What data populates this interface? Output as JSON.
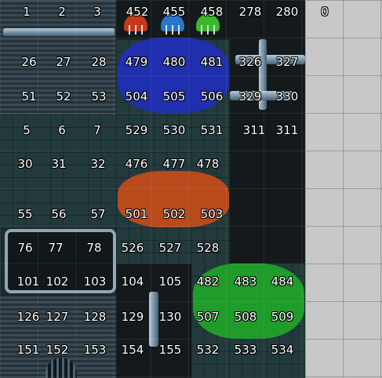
{
  "tile_labels": [
    {
      "label": "1"
    },
    {
      "label": "2"
    },
    {
      "label": "3"
    },
    {
      "label": "452"
    },
    {
      "label": "455"
    },
    {
      "label": "458"
    },
    {
      "label": "278"
    },
    {
      "label": "280"
    },
    {
      "label": "0"
    },
    {
      "label": "26"
    },
    {
      "label": "27"
    },
    {
      "label": "28"
    },
    {
      "label": "479"
    },
    {
      "label": "480"
    },
    {
      "label": "481"
    },
    {
      "label": "326"
    },
    {
      "label": "327"
    },
    {
      "label": "51"
    },
    {
      "label": "52"
    },
    {
      "label": "53"
    },
    {
      "label": "504"
    },
    {
      "label": "505"
    },
    {
      "label": "506"
    },
    {
      "label": "329"
    },
    {
      "label": "330"
    },
    {
      "label": "5"
    },
    {
      "label": "6"
    },
    {
      "label": "7"
    },
    {
      "label": "529"
    },
    {
      "label": "530"
    },
    {
      "label": "531"
    },
    {
      "label": "311"
    },
    {
      "label": "311"
    },
    {
      "label": "30"
    },
    {
      "label": "31"
    },
    {
      "label": "32"
    },
    {
      "label": "476"
    },
    {
      "label": "477"
    },
    {
      "label": "478"
    },
    {
      "label": "55"
    },
    {
      "label": "56"
    },
    {
      "label": "57"
    },
    {
      "label": "501"
    },
    {
      "label": "502"
    },
    {
      "label": "503"
    },
    {
      "label": "76"
    },
    {
      "label": "77"
    },
    {
      "label": "78"
    },
    {
      "label": "526"
    },
    {
      "label": "527"
    },
    {
      "label": "528"
    },
    {
      "label": "101"
    },
    {
      "label": "102"
    },
    {
      "label": "103"
    },
    {
      "label": "104"
    },
    {
      "label": "105"
    },
    {
      "label": "482"
    },
    {
      "label": "483"
    },
    {
      "label": "484"
    },
    {
      "label": "126"
    },
    {
      "label": "127"
    },
    {
      "label": "128"
    },
    {
      "label": "129"
    },
    {
      "label": "130"
    },
    {
      "label": "507"
    },
    {
      "label": "508"
    },
    {
      "label": "509"
    },
    {
      "label": "151"
    },
    {
      "label": "152"
    },
    {
      "label": "153"
    },
    {
      "label": "154"
    },
    {
      "label": "155"
    },
    {
      "label": "532"
    },
    {
      "label": "533"
    },
    {
      "label": "534"
    }
  ],
  "colors": {
    "blue_zone": "#1f2fae",
    "orange_zone": "#b84a1c",
    "green_zone": "#1f9c2a",
    "bulb_red": "#c63a1c",
    "bulb_blue": "#2a76c6",
    "bulb_green": "#3ab82a",
    "label_text": "#ffffff",
    "empty_grid": "#c8c8c8"
  }
}
